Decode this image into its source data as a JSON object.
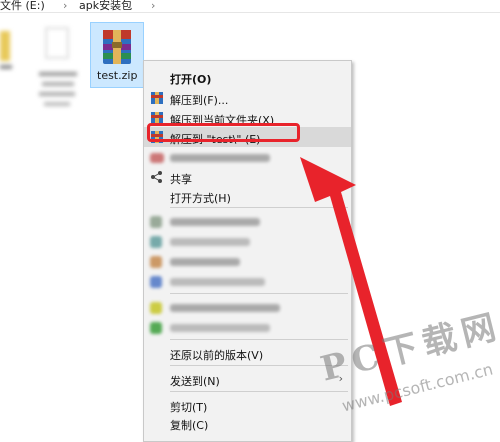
{
  "breadcrumb": {
    "drive": "文件 (E:)",
    "sep": "›",
    "folder": "apk安装包",
    "chevron": "›"
  },
  "files": [
    {
      "name": "test.zip",
      "selected": true
    }
  ],
  "context_menu": {
    "items": [
      {
        "label": "打开(O)",
        "bold": true
      },
      {
        "label": "解压到(F)..."
      },
      {
        "label": "解压到当前文件夹(X)"
      },
      {
        "label": "解压到 \"test\\\" (E)",
        "highlighted": true
      },
      {
        "label": "共享"
      },
      {
        "label": "打开方式(H)",
        "submenu": true
      },
      {
        "label": "还原以前的版本(V)"
      },
      {
        "label": "发送到(N)",
        "submenu": true
      },
      {
        "label": "剪切(T)"
      },
      {
        "label": "复制(C)"
      }
    ],
    "highlight_color": "#e8232b"
  },
  "watermark": {
    "brand": "PC下载网",
    "url": "www.pcsoft.com.cn"
  },
  "colors": {
    "arrow": "#e8232b",
    "selection": "#cce8ff",
    "menu_bg": "#f2f2f2"
  }
}
